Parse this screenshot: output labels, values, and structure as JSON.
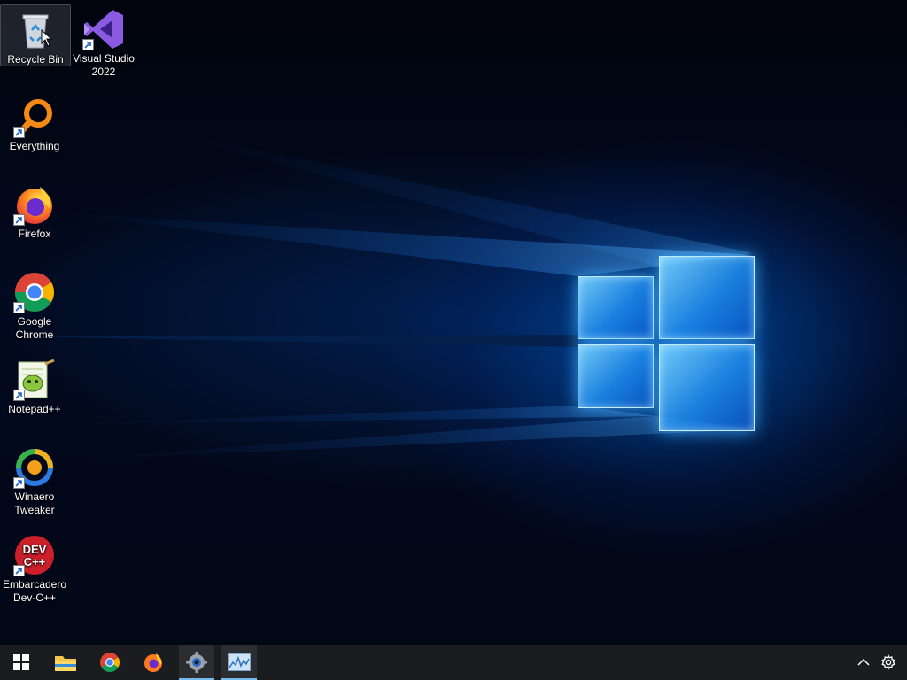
{
  "desktop": {
    "icons": [
      {
        "label": "Recycle Bin"
      },
      {
        "label": "Visual Studio\n2022"
      },
      {
        "label": "Everything"
      },
      {
        "label": "Firefox"
      },
      {
        "label": "Google\nChrome"
      },
      {
        "label": "Notepad++"
      },
      {
        "label": "Winaero\nTweaker"
      },
      {
        "label": "Embarcadero\nDev-C++"
      }
    ]
  },
  "taskbar": {
    "pinned": [
      "start-icon",
      "file-explorer-icon",
      "chrome-icon",
      "firefox-icon",
      "settings-app-icon",
      "resource-monitor-icon"
    ],
    "accent_color": "#76b9ed",
    "tray": [
      "show-hidden-icons-chevron-icon",
      "settings-gear-icon"
    ]
  }
}
